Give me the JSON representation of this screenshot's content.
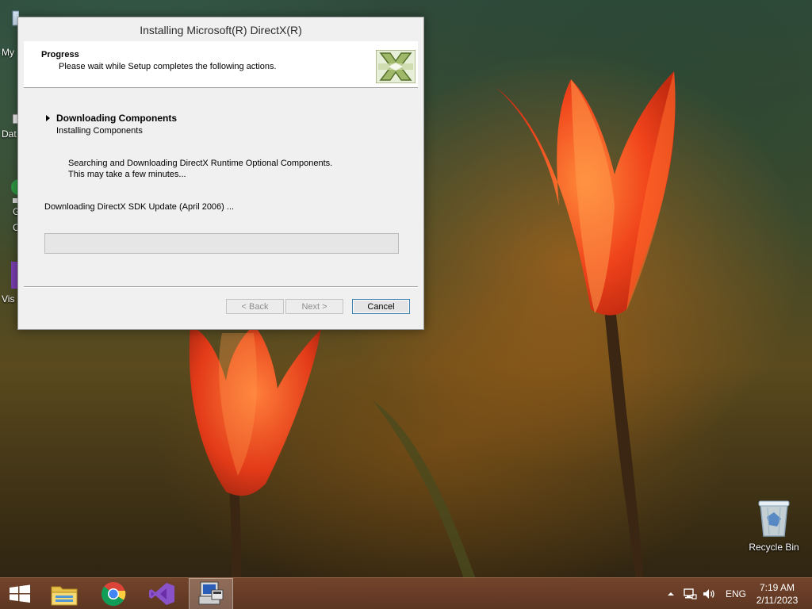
{
  "desktop": {
    "icons": [
      {
        "label": "My",
        "icon": "computer-icon"
      },
      {
        "label": "Dat",
        "icon": "database-icon"
      },
      {
        "label": "G",
        "icon": "chrome-icon"
      },
      {
        "label": "C",
        "icon": "app-icon"
      },
      {
        "label": "Vis",
        "icon": "visual-studio-icon"
      }
    ],
    "recycle_bin": {
      "label": "Recycle Bin",
      "icon": "recycle-bin-icon"
    }
  },
  "dialog": {
    "title": "Installing Microsoft(R) DirectX(R)",
    "header": {
      "title": "Progress",
      "subtitle": "Please wait while Setup completes the following actions.",
      "logo_icon": "directx-logo-icon"
    },
    "step": {
      "title": "Downloading Components",
      "subtitle": "Installing Components"
    },
    "detail": {
      "line1": "Searching and Downloading DirectX Runtime Optional Components.",
      "line2": "This may take a few minutes..."
    },
    "status": "Downloading DirectX SDK Update (April 2006) ...",
    "progress": {
      "value": 0
    },
    "buttons": {
      "back": "< Back",
      "next": "Next >",
      "cancel": "Cancel"
    }
  },
  "taskbar": {
    "items": [
      {
        "icon": "windows-start-icon"
      },
      {
        "icon": "file-explorer-icon"
      },
      {
        "icon": "chrome-icon"
      },
      {
        "icon": "visual-studio-icon"
      },
      {
        "icon": "setup-program-icon",
        "active": true
      }
    ],
    "tray": {
      "icons": [
        "chevron-up-icon",
        "network-icon",
        "volume-icon"
      ],
      "language": "ENG",
      "time": "7:19 AM",
      "date": "2/11/2023"
    }
  },
  "colors": {
    "dialog_bg": "#f0f0f0",
    "header_bg": "#ffffff",
    "taskbar": "#6e3f2a",
    "tulip": "#e8401a",
    "progress_fill": "#06b025"
  }
}
